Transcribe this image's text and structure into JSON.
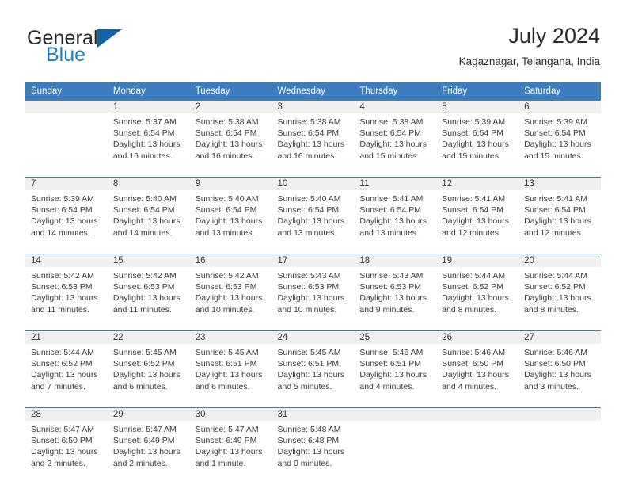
{
  "brand": {
    "name_part1": "General",
    "name_part2": "Blue",
    "triangle_color": "#1461a8",
    "blue_color": "#1b7fc4"
  },
  "header": {
    "title": "July 2024",
    "subtitle": "Kagaznagar, Telangana, India"
  },
  "theme": {
    "header_blue": "#3b7dbf",
    "band_gray": "#f0f0f0",
    "text_color": "#3a3a3a"
  },
  "weekdays": [
    "Sunday",
    "Monday",
    "Tuesday",
    "Wednesday",
    "Thursday",
    "Friday",
    "Saturday"
  ],
  "weeks": [
    [
      {
        "day": "",
        "lines": []
      },
      {
        "day": "1",
        "lines": [
          "Sunrise: 5:37 AM",
          "Sunset: 6:54 PM",
          "Daylight: 13 hours",
          "and 16 minutes."
        ]
      },
      {
        "day": "2",
        "lines": [
          "Sunrise: 5:38 AM",
          "Sunset: 6:54 PM",
          "Daylight: 13 hours",
          "and 16 minutes."
        ]
      },
      {
        "day": "3",
        "lines": [
          "Sunrise: 5:38 AM",
          "Sunset: 6:54 PM",
          "Daylight: 13 hours",
          "and 16 minutes."
        ]
      },
      {
        "day": "4",
        "lines": [
          "Sunrise: 5:38 AM",
          "Sunset: 6:54 PM",
          "Daylight: 13 hours",
          "and 15 minutes."
        ]
      },
      {
        "day": "5",
        "lines": [
          "Sunrise: 5:39 AM",
          "Sunset: 6:54 PM",
          "Daylight: 13 hours",
          "and 15 minutes."
        ]
      },
      {
        "day": "6",
        "lines": [
          "Sunrise: 5:39 AM",
          "Sunset: 6:54 PM",
          "Daylight: 13 hours",
          "and 15 minutes."
        ]
      }
    ],
    [
      {
        "day": "7",
        "lines": [
          "Sunrise: 5:39 AM",
          "Sunset: 6:54 PM",
          "Daylight: 13 hours",
          "and 14 minutes."
        ]
      },
      {
        "day": "8",
        "lines": [
          "Sunrise: 5:40 AM",
          "Sunset: 6:54 PM",
          "Daylight: 13 hours",
          "and 14 minutes."
        ]
      },
      {
        "day": "9",
        "lines": [
          "Sunrise: 5:40 AM",
          "Sunset: 6:54 PM",
          "Daylight: 13 hours",
          "and 13 minutes."
        ]
      },
      {
        "day": "10",
        "lines": [
          "Sunrise: 5:40 AM",
          "Sunset: 6:54 PM",
          "Daylight: 13 hours",
          "and 13 minutes."
        ]
      },
      {
        "day": "11",
        "lines": [
          "Sunrise: 5:41 AM",
          "Sunset: 6:54 PM",
          "Daylight: 13 hours",
          "and 13 minutes."
        ]
      },
      {
        "day": "12",
        "lines": [
          "Sunrise: 5:41 AM",
          "Sunset: 6:54 PM",
          "Daylight: 13 hours",
          "and 12 minutes."
        ]
      },
      {
        "day": "13",
        "lines": [
          "Sunrise: 5:41 AM",
          "Sunset: 6:54 PM",
          "Daylight: 13 hours",
          "and 12 minutes."
        ]
      }
    ],
    [
      {
        "day": "14",
        "lines": [
          "Sunrise: 5:42 AM",
          "Sunset: 6:53 PM",
          "Daylight: 13 hours",
          "and 11 minutes."
        ]
      },
      {
        "day": "15",
        "lines": [
          "Sunrise: 5:42 AM",
          "Sunset: 6:53 PM",
          "Daylight: 13 hours",
          "and 11 minutes."
        ]
      },
      {
        "day": "16",
        "lines": [
          "Sunrise: 5:42 AM",
          "Sunset: 6:53 PM",
          "Daylight: 13 hours",
          "and 10 minutes."
        ]
      },
      {
        "day": "17",
        "lines": [
          "Sunrise: 5:43 AM",
          "Sunset: 6:53 PM",
          "Daylight: 13 hours",
          "and 10 minutes."
        ]
      },
      {
        "day": "18",
        "lines": [
          "Sunrise: 5:43 AM",
          "Sunset: 6:53 PM",
          "Daylight: 13 hours",
          "and 9 minutes."
        ]
      },
      {
        "day": "19",
        "lines": [
          "Sunrise: 5:44 AM",
          "Sunset: 6:52 PM",
          "Daylight: 13 hours",
          "and 8 minutes."
        ]
      },
      {
        "day": "20",
        "lines": [
          "Sunrise: 5:44 AM",
          "Sunset: 6:52 PM",
          "Daylight: 13 hours",
          "and 8 minutes."
        ]
      }
    ],
    [
      {
        "day": "21",
        "lines": [
          "Sunrise: 5:44 AM",
          "Sunset: 6:52 PM",
          "Daylight: 13 hours",
          "and 7 minutes."
        ]
      },
      {
        "day": "22",
        "lines": [
          "Sunrise: 5:45 AM",
          "Sunset: 6:52 PM",
          "Daylight: 13 hours",
          "and 6 minutes."
        ]
      },
      {
        "day": "23",
        "lines": [
          "Sunrise: 5:45 AM",
          "Sunset: 6:51 PM",
          "Daylight: 13 hours",
          "and 6 minutes."
        ]
      },
      {
        "day": "24",
        "lines": [
          "Sunrise: 5:45 AM",
          "Sunset: 6:51 PM",
          "Daylight: 13 hours",
          "and 5 minutes."
        ]
      },
      {
        "day": "25",
        "lines": [
          "Sunrise: 5:46 AM",
          "Sunset: 6:51 PM",
          "Daylight: 13 hours",
          "and 4 minutes."
        ]
      },
      {
        "day": "26",
        "lines": [
          "Sunrise: 5:46 AM",
          "Sunset: 6:50 PM",
          "Daylight: 13 hours",
          "and 4 minutes."
        ]
      },
      {
        "day": "27",
        "lines": [
          "Sunrise: 5:46 AM",
          "Sunset: 6:50 PM",
          "Daylight: 13 hours",
          "and 3 minutes."
        ]
      }
    ],
    [
      {
        "day": "28",
        "lines": [
          "Sunrise: 5:47 AM",
          "Sunset: 6:50 PM",
          "Daylight: 13 hours",
          "and 2 minutes."
        ]
      },
      {
        "day": "29",
        "lines": [
          "Sunrise: 5:47 AM",
          "Sunset: 6:49 PM",
          "Daylight: 13 hours",
          "and 2 minutes."
        ]
      },
      {
        "day": "30",
        "lines": [
          "Sunrise: 5:47 AM",
          "Sunset: 6:49 PM",
          "Daylight: 13 hours",
          "and 1 minute."
        ]
      },
      {
        "day": "31",
        "lines": [
          "Sunrise: 5:48 AM",
          "Sunset: 6:48 PM",
          "Daylight: 13 hours",
          "and 0 minutes."
        ]
      },
      {
        "day": "",
        "lines": []
      },
      {
        "day": "",
        "lines": []
      },
      {
        "day": "",
        "lines": []
      }
    ]
  ]
}
